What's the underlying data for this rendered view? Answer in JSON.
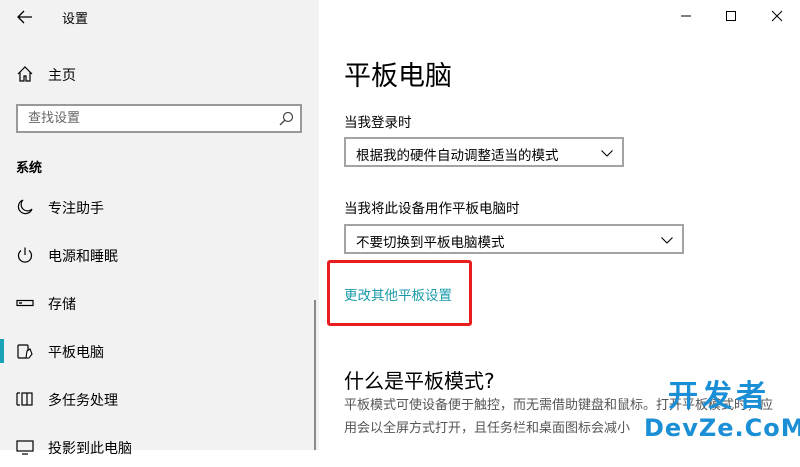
{
  "window": {
    "app_title": "设置",
    "minimize_icon": "minimize-icon",
    "maximize_icon": "maximize-icon",
    "close_icon": "close-icon"
  },
  "sidebar": {
    "home_label": "主页",
    "search": {
      "placeholder": "查找设置"
    },
    "section_header": "系统",
    "items": [
      {
        "label": "专注助手",
        "icon": "moon-icon"
      },
      {
        "label": "电源和睡眠",
        "icon": "power-icon"
      },
      {
        "label": "存储",
        "icon": "storage-icon"
      },
      {
        "label": "平板电脑",
        "icon": "tablet-icon",
        "selected": true
      },
      {
        "label": "多任务处理",
        "icon": "multitasking-icon"
      },
      {
        "label": "投影到此电脑",
        "icon": "project-icon"
      }
    ]
  },
  "main": {
    "title": "平板电脑",
    "signin_label": "当我登录时",
    "signin_value": "根据我的硬件自动调整适当的模式",
    "tablet_label": "当我将此设备用作平板电脑时",
    "tablet_value": "不要切换到平板电脑模式",
    "more_link": "更改其他平板设置",
    "what_title": "什么是平板模式?",
    "description": "平板模式可使设备便于触控，而无需借助键盘和鼠标。打开平板模式时，应用会以全屏方式打开，且任务栏和桌面图标会减小"
  },
  "watermark": {
    "top": "开发者",
    "bottom": "DevZe.CoM"
  },
  "colors": {
    "accent": "#1aa3b8",
    "link": "#1a9aa8",
    "highlight": "#e81e1e",
    "watermark": "#1a8fd6"
  }
}
